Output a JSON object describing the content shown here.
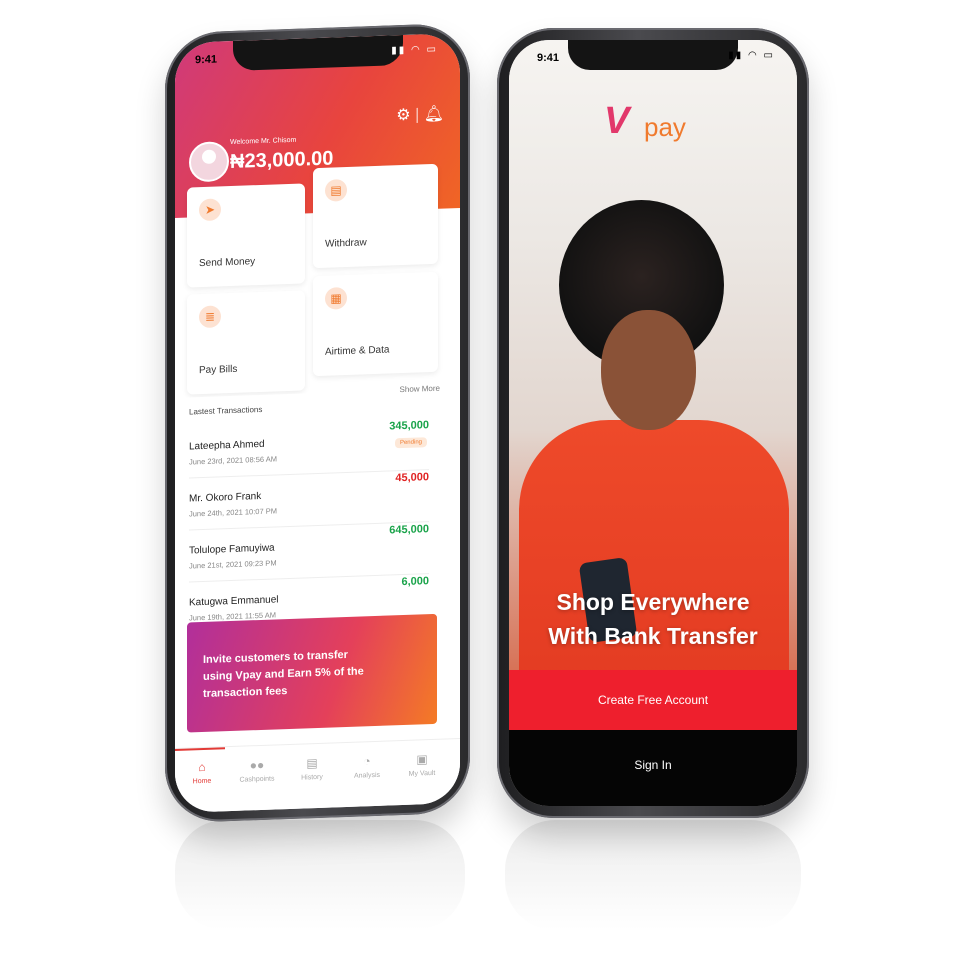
{
  "left_phone": {
    "status_time": "9:41",
    "header": {
      "welcome": "Welcome Mr. Chisom",
      "balance": "₦23,000.00",
      "settings_icon": "gear-icon",
      "notification_icon": "bell-icon"
    },
    "actions": [
      {
        "label": "Send Money",
        "icon": "paper-plane-icon"
      },
      {
        "label": "Withdraw",
        "icon": "cash-icon"
      },
      {
        "label": "Pay Bills",
        "icon": "bill-icon"
      },
      {
        "label": "Airtime & Data",
        "icon": "calculator-icon"
      }
    ],
    "transactions": {
      "title": "Lastest Transactions",
      "show_more": "Show More",
      "rows": [
        {
          "name": "Lateepha Ahmed",
          "date": "June 23rd, 2021 08:56 AM",
          "amount": "345,000",
          "status": "Pending",
          "color": "#1aa34a"
        },
        {
          "name": "Mr. Okoro Frank",
          "date": "June 24th, 2021 10:07 PM",
          "amount": "45,000",
          "status": "",
          "color": "#e02424"
        },
        {
          "name": "Tolulope Famuyiwa",
          "date": "June 21st, 2021 09:23 PM",
          "amount": "645,000",
          "status": "",
          "color": "#1aa34a"
        },
        {
          "name": "Katugwa Emmanuel",
          "date": "June 19th, 2021 11:55 AM",
          "amount": "6,000",
          "status": "",
          "color": "#1aa34a"
        }
      ]
    },
    "promo": "Invite customers to transfer using Vpay and Earn 5% of the transaction fees",
    "tabs": [
      {
        "label": "Home",
        "icon": "home-icon"
      },
      {
        "label": "Cashpoints",
        "icon": "users-icon"
      },
      {
        "label": "History",
        "icon": "document-icon"
      },
      {
        "label": "Analysis",
        "icon": "pie-chart-icon"
      },
      {
        "label": "My Vault",
        "icon": "wallet-icon"
      }
    ]
  },
  "right_phone": {
    "status_time": "9:41",
    "logo_mark": "V",
    "logo_text": "pay",
    "headline_line1": "Shop Everywhere",
    "headline_line2": "With Bank Transfer",
    "create_account": "Create Free Account",
    "sign_in": "Sign In"
  },
  "colors": {
    "accent_red": "#ee1f2d",
    "accent_orange": "#f07a2e",
    "accent_pink": "#d03a7a"
  }
}
